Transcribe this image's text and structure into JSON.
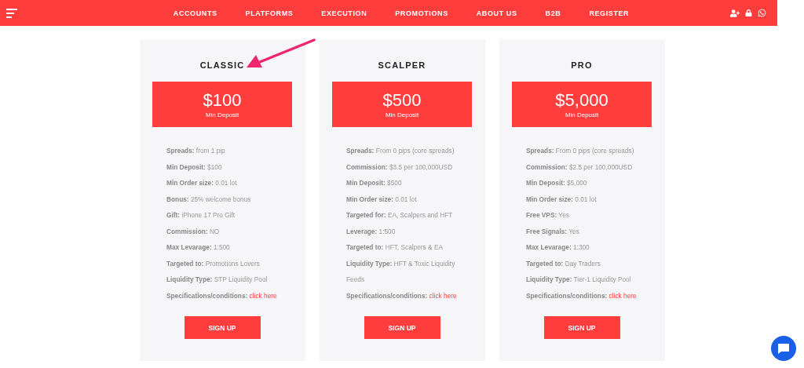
{
  "nav": {
    "items": [
      "ACCOUNTS",
      "PLATFORMS",
      "EXECUTION",
      "PROMOTIONS",
      "ABOUT US",
      "B2B",
      "REGISTER"
    ]
  },
  "plans": [
    {
      "name": "CLASSIC",
      "price": "$100",
      "caption": "Min Deposit",
      "button": "SIGN UP",
      "features": [
        {
          "label": "Spreads:",
          "value": "from 1 pip"
        },
        {
          "label": "Min Deposit:",
          "value": "$100"
        },
        {
          "label": "Min Order size:",
          "value": "0.01 lot"
        },
        {
          "label": "Bonus:",
          "value": "25% welcome bonus"
        },
        {
          "label": "Gift:",
          "value": "iPhone 17 Pro Gift"
        },
        {
          "label": "Commission:",
          "value": "NO"
        },
        {
          "label": "Max Levarage:",
          "value": "1:500"
        },
        {
          "label": "Targeted to:",
          "value": "Promotions Lovers"
        },
        {
          "label": "Liquidity Type:",
          "value": "STP Liquidity Pool"
        },
        {
          "label": "Specifications/conditions:",
          "link": "click here"
        }
      ]
    },
    {
      "name": "SCALPER",
      "price": "$500",
      "caption": "Min Deposit",
      "button": "SIGN UP",
      "features": [
        {
          "label": "Spreads:",
          "value": "From 0 pips (core spreads)"
        },
        {
          "label": "Commission:",
          "value": "$3.5 per 100,000USD"
        },
        {
          "label": "Min Deposit:",
          "value": "$500"
        },
        {
          "label": "Min Order size:",
          "value": "0.01 lot"
        },
        {
          "label": "Targeted for:",
          "value": "EA, Scalpers and HFT"
        },
        {
          "label": "Leverage:",
          "value": "1:500"
        },
        {
          "label": "Targeted to:",
          "value": "HFT, Scalpers & EA"
        },
        {
          "label": "Liquidity Type:",
          "value": "HFT & Toxic Liquidity Feeds"
        },
        {
          "label": "Specifications/conditions:",
          "link": "click here"
        }
      ]
    },
    {
      "name": "PRO",
      "price": "$5,000",
      "caption": "Min Deposit",
      "button": "SIGN UP",
      "features": [
        {
          "label": "Spreads:",
          "value": "From 0 pips (core spreads)"
        },
        {
          "label": "Commission:",
          "value": "$2.5 per 100,000USD"
        },
        {
          "label": "Min Deposit:",
          "value": "$5,000"
        },
        {
          "label": "Min Order size:",
          "value": "0.01 lot"
        },
        {
          "label": "Free VPS:",
          "value": "Yes"
        },
        {
          "label": "Free Signals:",
          "value": "Yes"
        },
        {
          "label": "Max Levarage:",
          "value": "1:300"
        },
        {
          "label": "Targeted to:",
          "value": "Day Traders"
        },
        {
          "label": "Liquidity Type:",
          "value": "Tier-1 Liquidity Pool"
        },
        {
          "label": "Specifications/conditions:",
          "link": "click here"
        }
      ]
    }
  ]
}
